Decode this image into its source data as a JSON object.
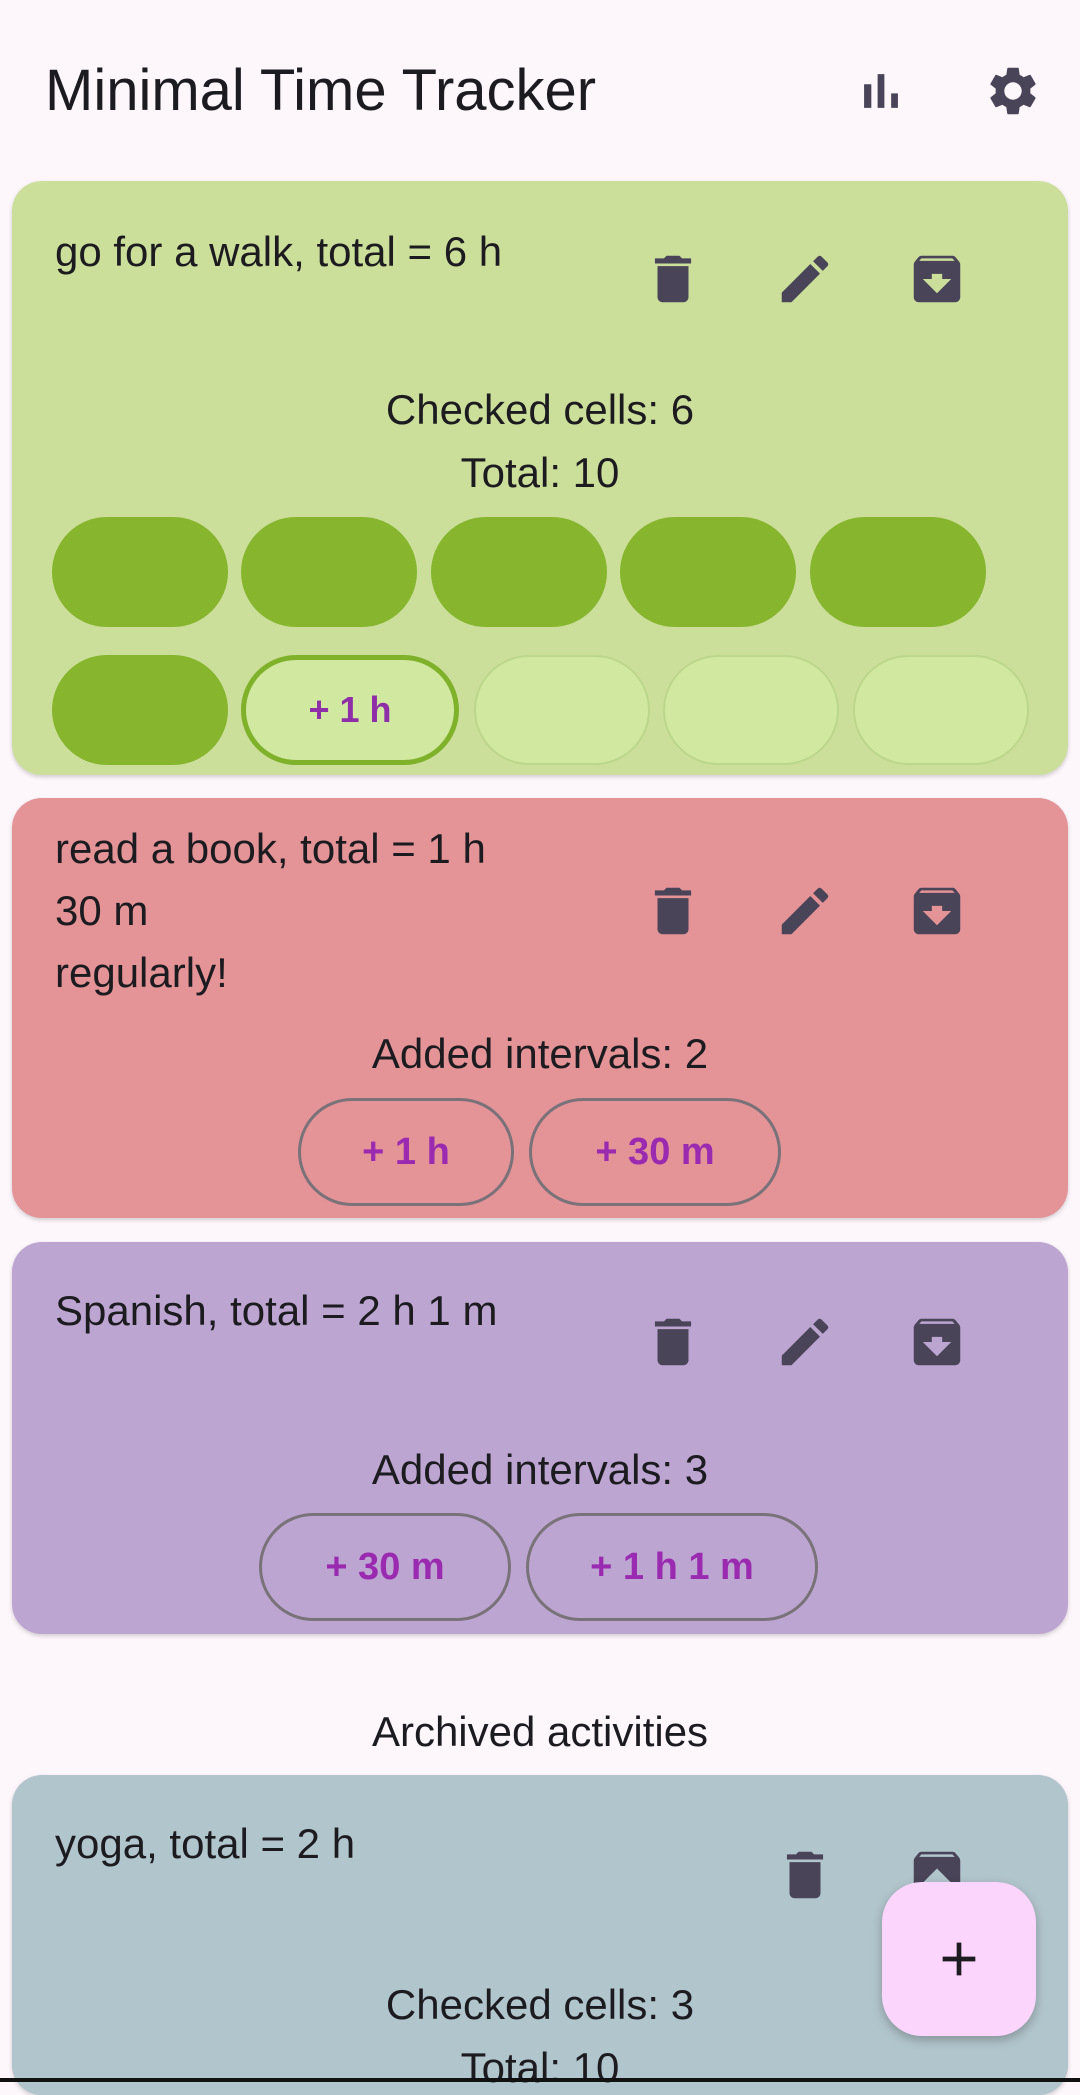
{
  "app": {
    "title": "Minimal Time Tracker",
    "actions": [
      {
        "name": "statistics",
        "icon": "bar-chart-icon"
      },
      {
        "name": "settings",
        "icon": "gear-icon"
      }
    ]
  },
  "activities": [
    {
      "title": "go for a walk, total = 6 h",
      "color": "#cbdf9b",
      "stats": [
        "Checked cells: 6",
        "Total: 10"
      ],
      "cells": {
        "checked": 6,
        "total": 10,
        "add_label": "+ 1 h"
      }
    },
    {
      "title": "read a book, total = 1 h\n30 m\nregularly!",
      "color": "#e49397",
      "stats": [
        "Added intervals: 2"
      ],
      "intervals": [
        "+ 1 h",
        "+ 30 m"
      ]
    },
    {
      "title": "Spanish, total = 2 h 1 m",
      "color": "#bda5d2",
      "stats": [
        "Added intervals: 3"
      ],
      "intervals": [
        "+ 30 m",
        "+ 1 h 1 m"
      ]
    }
  ],
  "archived": {
    "label": "Archived activities",
    "items": [
      {
        "title": "yoga, total = 2 h",
        "color": "#b1c5cc",
        "stats": [
          "Checked cells: 3",
          "Total: 10"
        ]
      }
    ]
  },
  "card_actions": [
    "delete-icon",
    "edit-icon",
    "archive-icon"
  ],
  "fab": {
    "icon": "plus-icon"
  }
}
